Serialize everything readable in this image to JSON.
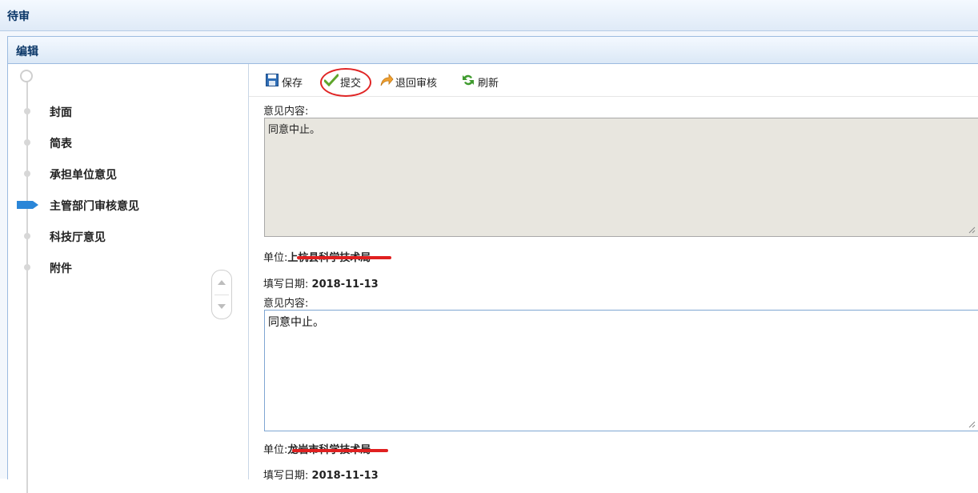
{
  "window": {
    "title": "待审"
  },
  "panel": {
    "title": "编辑"
  },
  "sidebar": {
    "items": [
      {
        "label": "封面",
        "active": false
      },
      {
        "label": "简表",
        "active": false
      },
      {
        "label": "承担单位意见",
        "active": false
      },
      {
        "label": "主管部门审核意见",
        "active": true
      },
      {
        "label": "科技厅意见",
        "active": false
      },
      {
        "label": "附件",
        "active": false
      }
    ],
    "scroll_up_icon": "caret-up-icon",
    "scroll_down_icon": "caret-down-icon"
  },
  "toolbar": {
    "save_label": "保存",
    "submit_label": "提交",
    "return_label": "退回审核",
    "refresh_label": "刷新"
  },
  "opinion1": {
    "content_label": "意见内容:",
    "content": "同意中止。",
    "unit_label": "单位:",
    "unit_value": "上杭县科学技术局",
    "date_label": "填写日期:",
    "date_value": "2018-11-13"
  },
  "opinion2": {
    "content_label": "意见内容:",
    "content": "同意中止。",
    "unit_label": "单位:",
    "unit_value": "龙岩市科学技术局",
    "date_label": "填写日期:",
    "date_value": "2018-11-13"
  },
  "colors": {
    "header_text": "#0b3768",
    "active_marker": "#2a86d8",
    "annotation": "#e02525",
    "readonly_bg": "#e8e6df"
  }
}
